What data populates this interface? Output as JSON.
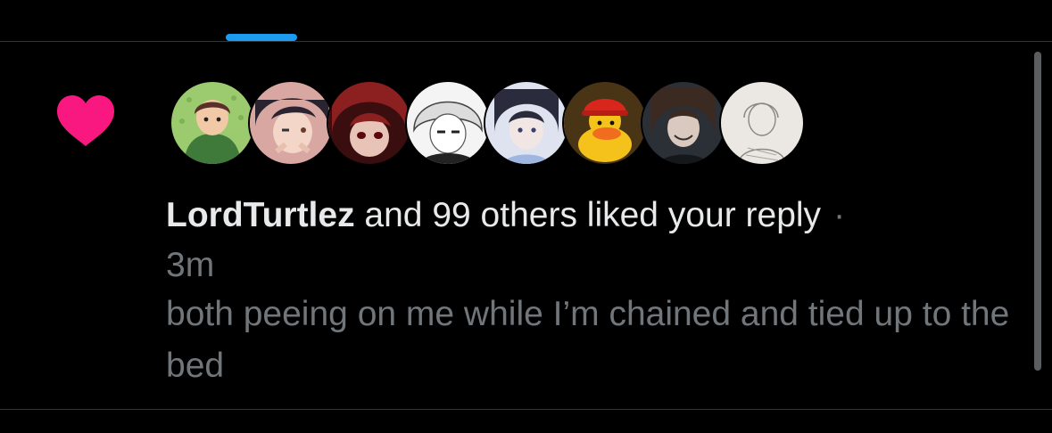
{
  "colors": {
    "background": "#000000",
    "accent": "#1d9bf0",
    "like": "#f91880",
    "primary_text": "#e7e9ea",
    "secondary_text": "#71767b",
    "divider": "#2f3336"
  },
  "notification": {
    "icon": "heart-icon",
    "avatars": [
      {
        "name": "avatar-1",
        "desc": "green hoodie cartoon"
      },
      {
        "name": "avatar-2",
        "desc": "anime girl"
      },
      {
        "name": "avatar-3",
        "desc": "red hair anime"
      },
      {
        "name": "avatar-4",
        "desc": "white hair manga"
      },
      {
        "name": "avatar-5",
        "desc": "dark hair anime"
      },
      {
        "name": "avatar-6",
        "desc": "rubber duck"
      },
      {
        "name": "avatar-7",
        "desc": "dark anime"
      },
      {
        "name": "avatar-8",
        "desc": "sketch"
      }
    ],
    "user": "LordTurtlez",
    "action": " and 99 others liked your reply",
    "separator": "·",
    "time": "3m",
    "reply": "both peeing on me while I’m chained and tied up to the bed"
  }
}
